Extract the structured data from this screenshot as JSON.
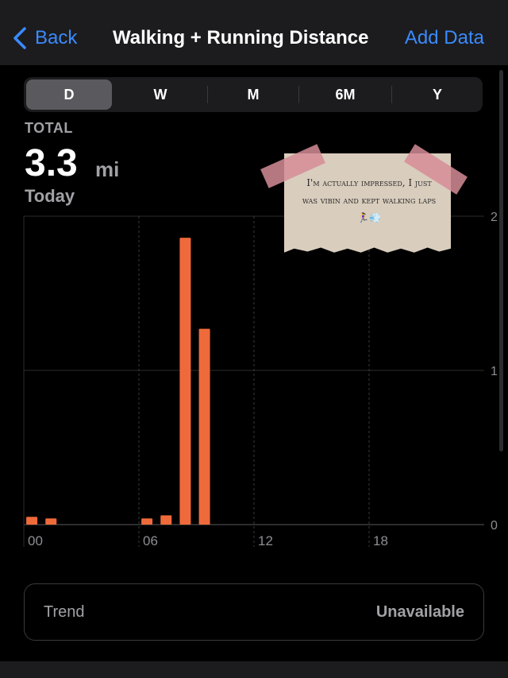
{
  "nav": {
    "back_label": "Back",
    "title": "Walking + Running Distance",
    "add_label": "Add Data"
  },
  "periods": [
    "D",
    "W",
    "M",
    "6M",
    "Y"
  ],
  "selected_period": "D",
  "summary": {
    "label": "TOTAL",
    "value": "3.3",
    "unit": "mi",
    "date": "Today"
  },
  "note": {
    "text": "I'm actually impressed, I just was vibin and kept walking laps 🏃‍♀️💨"
  },
  "trend": {
    "label": "Trend",
    "value": "Unavailable"
  },
  "colors": {
    "accent": "#3a8bff",
    "bar": "#ef6a3a"
  },
  "chart_data": {
    "type": "bar",
    "x_tick_labels": [
      "00",
      "06",
      "12",
      "18"
    ],
    "y_tick_labels": [
      "0",
      "1",
      "2"
    ],
    "ylim": [
      0,
      2
    ],
    "x": [
      0,
      1,
      6,
      7,
      8,
      9
    ],
    "values": [
      0.05,
      0.04,
      0.04,
      0.06,
      1.86,
      1.27
    ],
    "grid": true
  }
}
